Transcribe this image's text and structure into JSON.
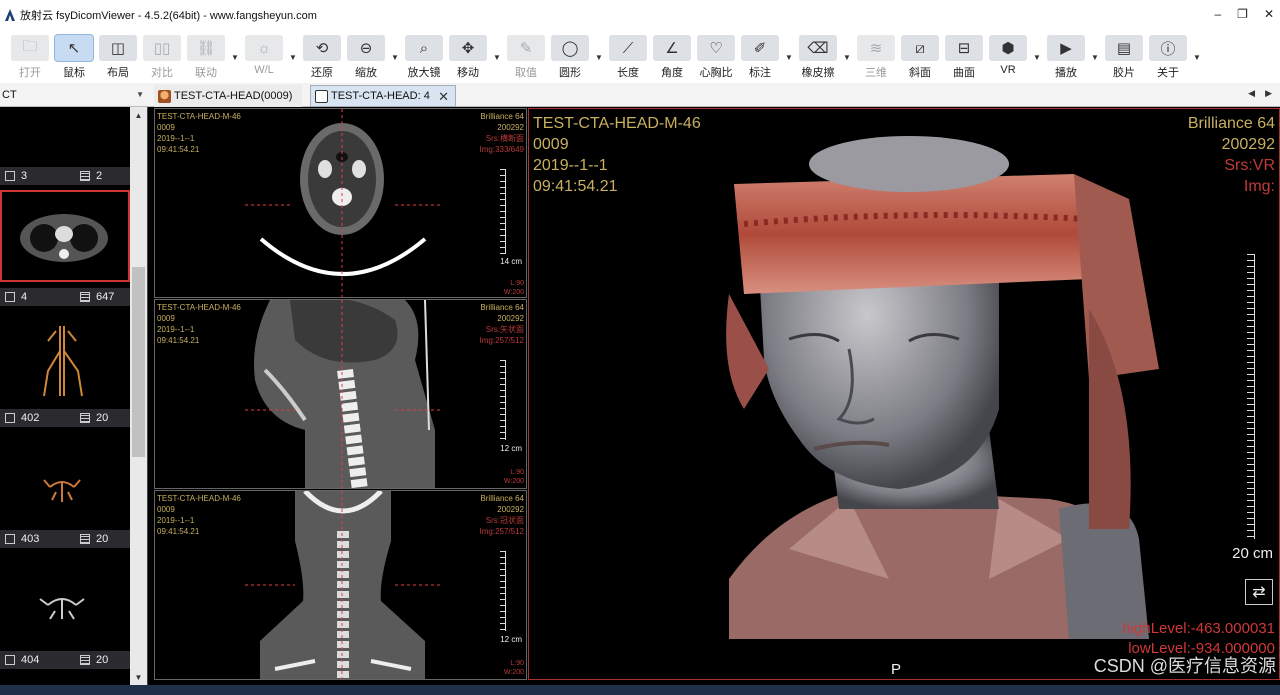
{
  "app": {
    "title": "放射云 fsyDicomViewer - 4.5.2(64bit) - www.fangsheyun.com",
    "window_controls": [
      "‒",
      "❐",
      "✕"
    ]
  },
  "toolbar": {
    "tools": [
      {
        "label": "打开",
        "icon": "folder-icon",
        "state": "disabled"
      },
      {
        "label": "鼠标",
        "icon": "cursor-icon",
        "state": "active"
      },
      {
        "label": "布局",
        "icon": "layout-icon",
        "state": "normal"
      },
      {
        "label": "对比",
        "icon": "compare-icon",
        "state": "disabled"
      },
      {
        "label": "联动",
        "icon": "link-icon",
        "state": "disabled"
      },
      {
        "label": "W/L",
        "icon": "brightness-icon",
        "state": "disabled"
      },
      {
        "label": "还原",
        "icon": "reset-icon",
        "state": "normal"
      },
      {
        "label": "缩放",
        "icon": "zoom-icon",
        "state": "normal"
      },
      {
        "label": "放大镜",
        "icon": "magnifier-icon",
        "state": "normal"
      },
      {
        "label": "移动",
        "icon": "move-icon",
        "state": "normal"
      },
      {
        "label": "取值",
        "icon": "pipette-icon",
        "state": "disabled"
      },
      {
        "label": "圆形",
        "icon": "ellipse-icon",
        "state": "normal"
      },
      {
        "label": "长度",
        "icon": "ruler-icon",
        "state": "normal"
      },
      {
        "label": "角度",
        "icon": "angle-icon",
        "state": "normal"
      },
      {
        "label": "心胸比",
        "icon": "heart-icon",
        "state": "normal"
      },
      {
        "label": "标注",
        "icon": "pen-icon",
        "state": "normal"
      },
      {
        "label": "橡皮擦",
        "icon": "eraser-icon",
        "state": "normal"
      },
      {
        "label": "三维",
        "icon": "layers-icon",
        "state": "disabled"
      },
      {
        "label": "斜面",
        "icon": "oblique-icon",
        "state": "normal"
      },
      {
        "label": "曲面",
        "icon": "curved-icon",
        "state": "normal"
      },
      {
        "label": "VR",
        "icon": "cube-icon",
        "state": "normal"
      },
      {
        "label": "播放",
        "icon": "play-icon",
        "state": "normal"
      },
      {
        "label": "胶片",
        "icon": "film-icon",
        "state": "normal"
      },
      {
        "label": "关于",
        "icon": "info-icon",
        "state": "normal"
      }
    ]
  },
  "tabs": {
    "series_select": "CT",
    "items": [
      {
        "label": "TEST-CTA-HEAD(0009)"
      },
      {
        "label": "TEST-CTA-HEAD: 4"
      }
    ]
  },
  "series": [
    {
      "series_no": "3",
      "images": "2"
    },
    {
      "series_no": "4",
      "images": "647"
    },
    {
      "series_no": "402",
      "images": "20"
    },
    {
      "series_no": "403",
      "images": "20"
    },
    {
      "series_no": "404",
      "images": "20"
    }
  ],
  "viewports": {
    "small": [
      {
        "name": "TEST-CTA-HEAD-M-46",
        "id": "0009",
        "date": "2019--1--1",
        "time": "09:41:54.21",
        "device": "Brilliance 64",
        "code": "200292",
        "srs": "Srs:横断面",
        "img": "Img:333/649",
        "scale": "14 cm",
        "l": "L:90",
        "w": "W:200"
      },
      {
        "name": "TEST-CTA-HEAD-M-46",
        "id": "0009",
        "date": "2019--1--1",
        "time": "09:41:54.21",
        "device": "Brilliance 64",
        "code": "200292",
        "srs": "Srs:矢状面",
        "img": "Img:257/512",
        "scale": "12 cm",
        "l": "L:90",
        "w": "W:200"
      },
      {
        "name": "TEST-CTA-HEAD-M-46",
        "id": "0009",
        "date": "2019--1--1",
        "time": "09:41:54.21",
        "device": "Brilliance 64",
        "code": "200292",
        "srs": "Srs:冠状面",
        "img": "Img:257/512",
        "scale": "12 cm",
        "l": "L:90",
        "w": "W:200"
      }
    ],
    "vr": {
      "name": "TEST-CTA-HEAD-M-46",
      "id": "0009",
      "date": "2019--1--1",
      "time": "09:41:54.21",
      "device": "Brilliance 64",
      "code": "200292",
      "srs": "Srs:VR",
      "img": "Img:",
      "scale": "20 cm",
      "high": "highLevel:-463.000031",
      "low": "lowLevel:-934.000000",
      "orientation": "P"
    }
  },
  "watermark": "CSDN @医疗信息资源",
  "colors": {
    "overlay_yellow": "#c8b060",
    "overlay_red": "#b63a3a",
    "active_border": "#a33"
  }
}
